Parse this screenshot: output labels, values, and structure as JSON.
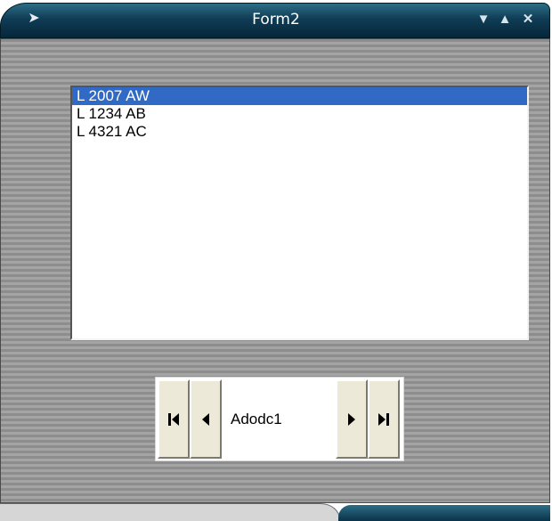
{
  "window": {
    "title": "Form2",
    "system_menu_icon": "arrow-menu-icon",
    "minimize_icon": "minimize-icon",
    "maximize_icon": "maximize-icon",
    "close_icon": "close-icon"
  },
  "listbox": {
    "items": [
      {
        "label": "L 2007 AW",
        "selected": true
      },
      {
        "label": "L 1234 AB",
        "selected": false
      },
      {
        "label": "L 4321 AC",
        "selected": false
      }
    ]
  },
  "adodc": {
    "caption": "Adodc1",
    "first_icon": "first-record-icon",
    "prev_icon": "previous-record-icon",
    "next_icon": "next-record-icon",
    "last_icon": "last-record-icon"
  },
  "colors": {
    "title_bar": "#0f3d55",
    "selection": "#316ac5",
    "client_stripes": "#8d8d8d"
  }
}
